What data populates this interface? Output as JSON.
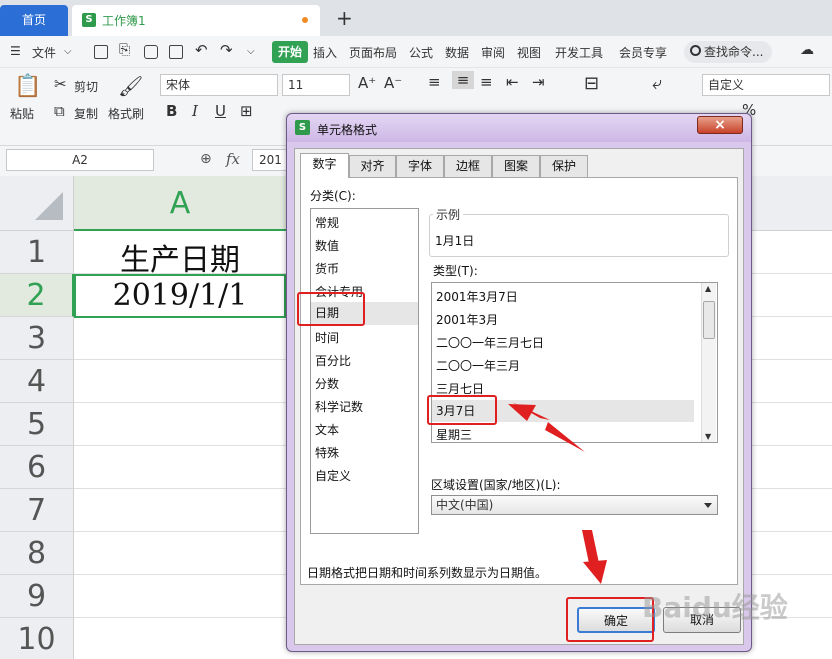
{
  "titlebar": {
    "home_tab": "首页",
    "doc_tab": "工作簿1",
    "doc_icon": "S",
    "add_tab": "+"
  },
  "menubar": {
    "file": "文件",
    "items": [
      "开始",
      "插入",
      "页面布局",
      "公式",
      "数据",
      "审阅",
      "视图",
      "开发工具",
      "会员专享"
    ],
    "search": "查找命令..."
  },
  "ribbon": {
    "paste": "粘贴",
    "cut": "剪切",
    "copy": "复制",
    "format_painter": "格式刷",
    "font_name": "宋体",
    "font_size": "11",
    "bold": "B",
    "italic": "I",
    "underline": "U",
    "number_format": "自定义",
    "merge": "合并居中",
    "wrap": "自动换行",
    "percent": "%"
  },
  "formula_bar": {
    "name_box": "A2",
    "fx": "fx",
    "value": "201"
  },
  "grid": {
    "column_header": "A",
    "row_headers": [
      "1",
      "2",
      "3",
      "4",
      "5",
      "6",
      "7",
      "8",
      "9",
      "10"
    ],
    "cells": {
      "a1": "生产日期",
      "a2": "2019/1/1"
    }
  },
  "dialog": {
    "title": "单元格格式",
    "close": "×",
    "tabs": [
      "数字",
      "对齐",
      "字体",
      "边框",
      "图案",
      "保护"
    ],
    "category_label": "分类(C):",
    "categories": [
      "常规",
      "数值",
      "货币",
      "会计专用",
      "日期",
      "时间",
      "百分比",
      "分数",
      "科学记数",
      "文本",
      "特殊",
      "自定义"
    ],
    "selected_category": "日期",
    "sample_label": "示例",
    "sample_value": "1月1日",
    "type_label": "类型(T):",
    "types": [
      "2001年3月7日",
      "2001年3月",
      "二〇〇一年三月七日",
      "二〇〇一年三月",
      "三月七日",
      "3月7日",
      "星期三"
    ],
    "selected_type": "3月7日",
    "locale_label": "区域设置(国家/地区)(L):",
    "locale_value": "中文(中国)",
    "description": "日期格式把日期和时间系列数显示为日期值。",
    "ok": "确定",
    "cancel": "取消"
  },
  "watermark": "Baidu经验",
  "colors": {
    "accent_green": "#31a154",
    "home_blue": "#2b6fd6",
    "annotation_red": "#e02020",
    "dialog_frame": "#d9c8eb"
  }
}
